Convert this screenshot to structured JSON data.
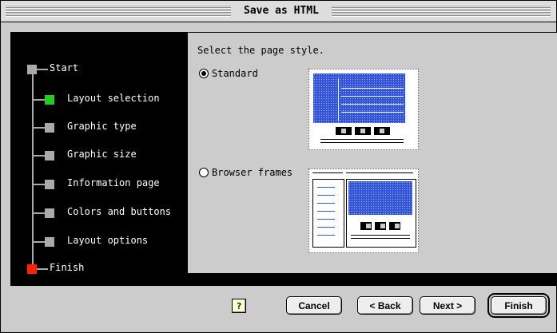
{
  "window": {
    "title": "Save as HTML"
  },
  "steps": [
    {
      "label": "Start",
      "state": "done"
    },
    {
      "label": "Layout selection",
      "state": "current"
    },
    {
      "label": "Graphic type",
      "state": "pending"
    },
    {
      "label": "Graphic size",
      "state": "pending"
    },
    {
      "label": "Information page",
      "state": "pending"
    },
    {
      "label": "Colors and buttons",
      "state": "pending"
    },
    {
      "label": "Layout options",
      "state": "pending"
    },
    {
      "label": "Finish",
      "state": "finish"
    }
  ],
  "content": {
    "prompt": "Select the page style.",
    "options": [
      {
        "label": "Standard",
        "selected": true
      },
      {
        "label": "Browser frames",
        "selected": false
      }
    ]
  },
  "buttons": {
    "help": "?",
    "cancel": "Cancel",
    "back": "< Back",
    "next": "Next >",
    "finish": "Finish"
  },
  "colors": {
    "current_step": "#22cc22",
    "finish_step": "#ff2200",
    "preview_blue": "#3355dd"
  }
}
